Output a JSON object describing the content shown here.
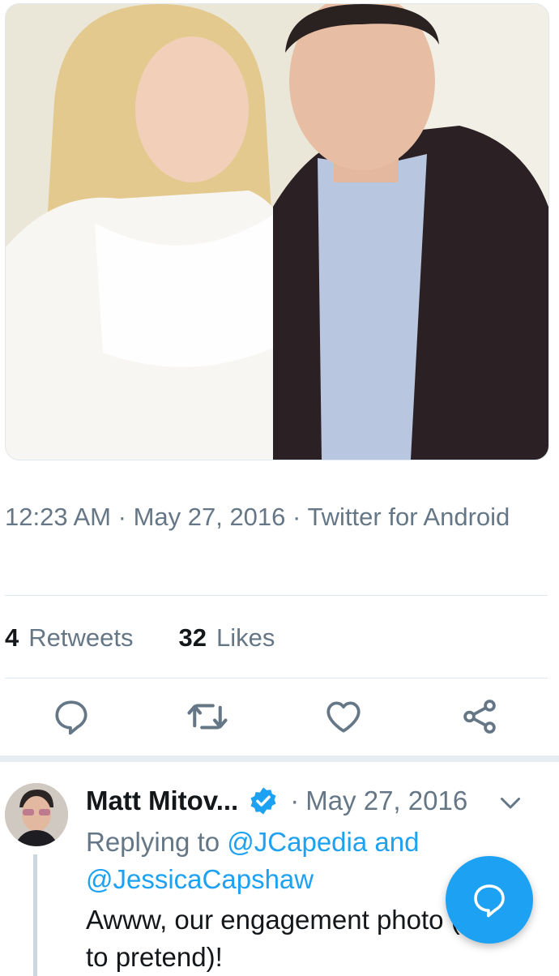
{
  "tweet": {
    "time": "12:23 AM",
    "date": "May 27, 2016",
    "source": "Twitter for Android"
  },
  "stats": {
    "retweets_count": "4",
    "retweets_label": "Retweets",
    "likes_count": "32",
    "likes_label": "Likes"
  },
  "actions": [
    "reply-icon",
    "retweet-icon",
    "like-icon",
    "share-icon"
  ],
  "reply": {
    "name": "Matt Mitov...",
    "separator": "·",
    "date": "May 27, 2016",
    "replying_prefix": "Replying to",
    "mention_1": "@JCapedia",
    "conjunction": "and",
    "mention_2": "@JessicaCapshaw",
    "text": "Awww, our engagement photo (I like to pretend)!"
  },
  "colors": {
    "accent": "#1da1f2",
    "secondary_text": "#657786",
    "divider": "#e1e8ed"
  }
}
